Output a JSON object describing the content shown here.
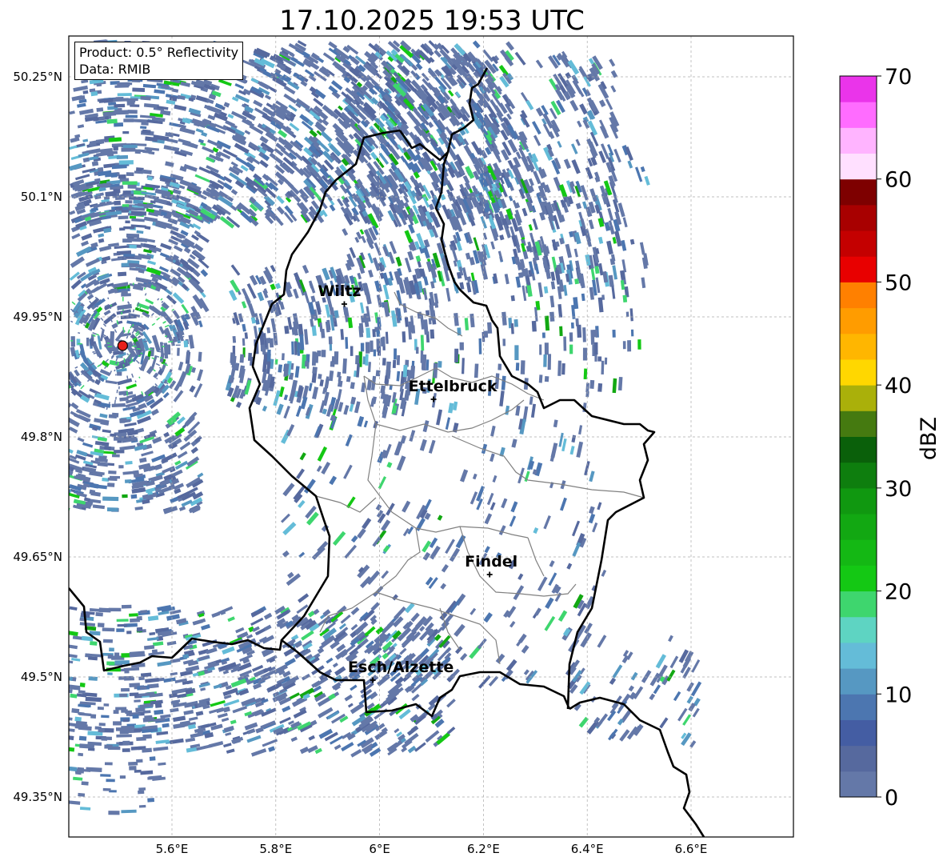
{
  "title": "17.10.2025 19:53 UTC",
  "info_box": {
    "product": "Product: 0.5° Reflectivity",
    "data": "Data: RMIB"
  },
  "map": {
    "lon_range": [
      5.4,
      6.8
    ],
    "lat_range": [
      49.3,
      50.3
    ],
    "lat_ticks": [
      {
        "value": 50.25,
        "label": "50.25°N"
      },
      {
        "value": 50.1,
        "label": "50.1°N"
      },
      {
        "value": 49.95,
        "label": "49.95°N"
      },
      {
        "value": 49.8,
        "label": "49.8°N"
      },
      {
        "value": 49.65,
        "label": "49.65°N"
      },
      {
        "value": 49.5,
        "label": "49.5°N"
      },
      {
        "value": 49.35,
        "label": "49.35°N"
      }
    ],
    "lon_ticks": [
      {
        "value": 5.6,
        "label": "5.6°E"
      },
      {
        "value": 5.8,
        "label": "5.8°E"
      },
      {
        "value": 6.0,
        "label": "6°E"
      },
      {
        "value": 6.2,
        "label": "6.2°E"
      },
      {
        "value": 6.4,
        "label": "6.4°E"
      },
      {
        "value": 6.6,
        "label": "6.6°E"
      }
    ],
    "gridlines": true,
    "radar_site": {
      "lon": 5.505,
      "lat": 49.914,
      "color": "#e8201c"
    },
    "cities": [
      {
        "name": "Wiltz",
        "lon": 5.932,
        "lat": 49.966
      },
      {
        "name": "Ettelbruck",
        "lon": 6.104,
        "lat": 49.847
      },
      {
        "name": "Findel",
        "lon": 6.212,
        "lat": 49.628
      },
      {
        "name": "Esch/Alzette",
        "lon": 5.987,
        "lat": 49.496
      }
    ],
    "border_color": "#000000",
    "canton_color": "#808080"
  },
  "colorbar": {
    "label": "dBZ",
    "min": 0,
    "max": 70,
    "step": 2.5,
    "ticks": [
      "0",
      "10",
      "20",
      "30",
      "40",
      "50",
      "60",
      "70"
    ],
    "colors": [
      "#6478a8",
      "#56699e",
      "#445da3",
      "#4c76b0",
      "#5698c2",
      "#64bcd8",
      "#5ed4c2",
      "#3ed66e",
      "#14c814",
      "#14b814",
      "#12a812",
      "#109810",
      "#0e7e0e",
      "#0a600a",
      "#457a10",
      "#aab00a",
      "#ffd700",
      "#ffb600",
      "#ff9c00",
      "#ff8000",
      "#e80000",
      "#c40000",
      "#a80000",
      "#7e0000",
      "#ffe0ff",
      "#ffb4ff",
      "#ff6cff",
      "#ea34ea"
    ]
  }
}
